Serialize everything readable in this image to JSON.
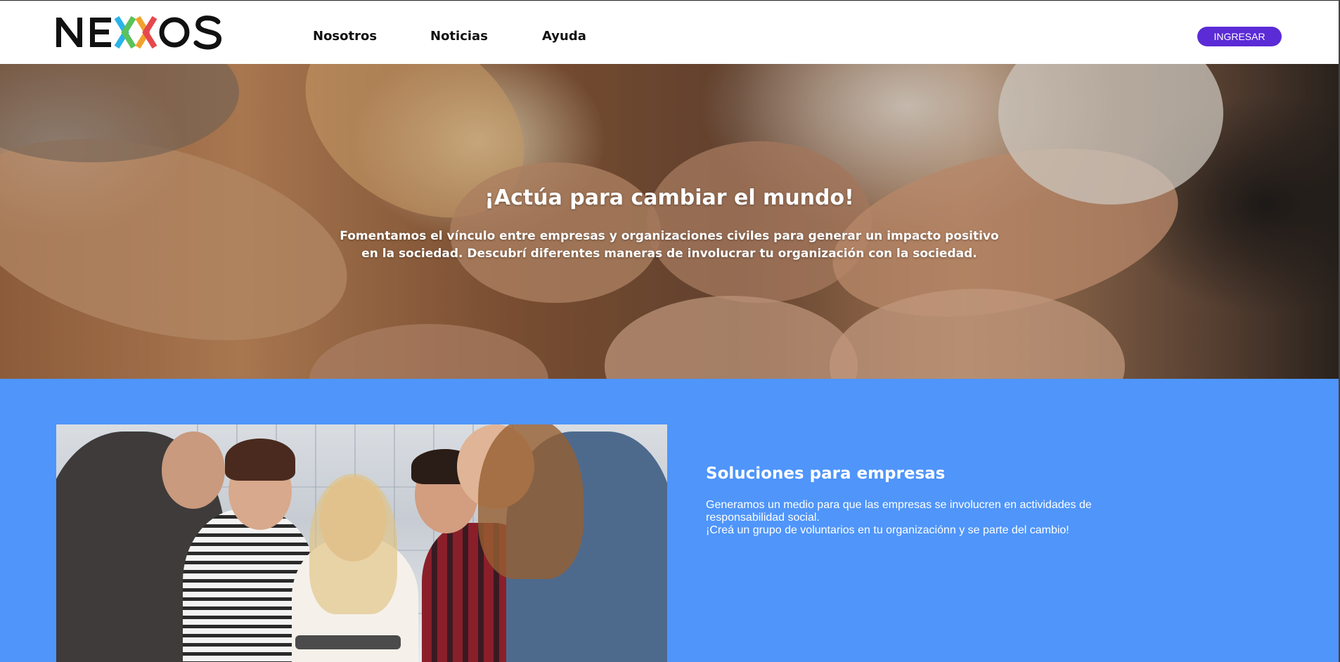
{
  "header": {
    "logo_text": "NEXOS",
    "nav": [
      {
        "label": "Nosotros"
      },
      {
        "label": "Noticias"
      },
      {
        "label": "Ayuda"
      }
    ],
    "login_label": "INGRESAR",
    "login_color": "#5B2BD6"
  },
  "hero": {
    "title": "¡Actúa para cambiar el mundo!",
    "text": "Fomentamos el vínculo entre empresas y organizaciones civiles para generar un impacto positivo en la sociedad. Descubrí diferentes maneras de involucrar tu organización con la sociedad."
  },
  "solutions": {
    "title": "Soluciones para empresas",
    "line1": "Generamos un medio para que las empresas se involucren en actividades de responsabilidad social.",
    "line2": "¡Creá un grupo de voluntarios en tu organizaciónn y se parte del cambio!",
    "background_color": "#4F95FA"
  }
}
